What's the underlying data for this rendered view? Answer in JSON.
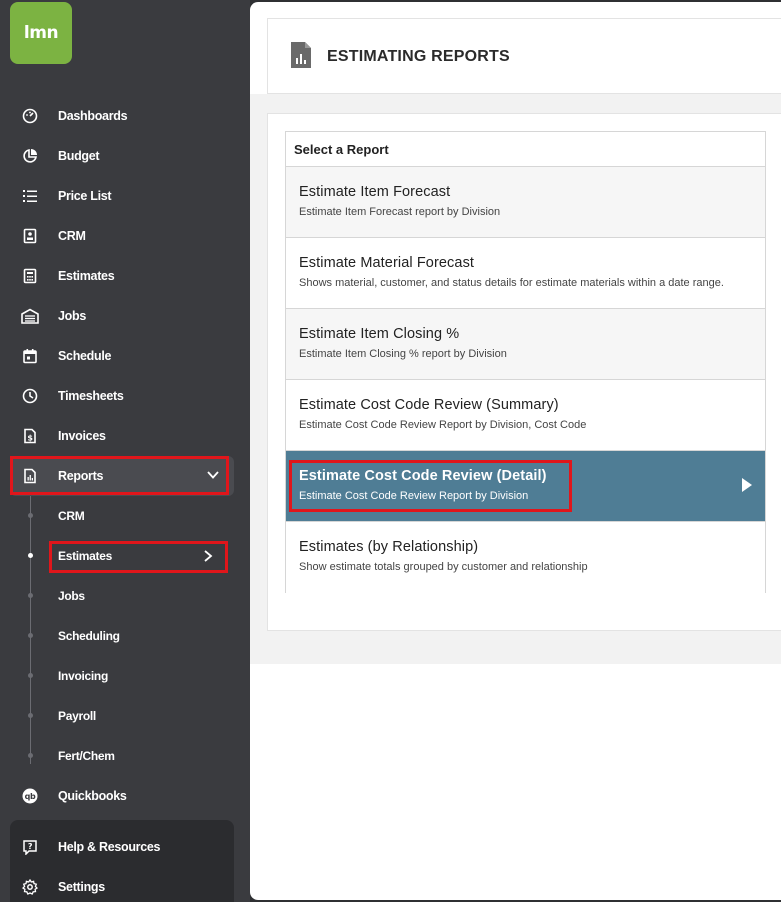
{
  "app": {
    "logo_text": "lmn"
  },
  "sidebar": {
    "items": [
      {
        "label": "Dashboards",
        "icon": "dashboard-gauge-icon"
      },
      {
        "label": "Budget",
        "icon": "pie-chart-icon"
      },
      {
        "label": "Price List",
        "icon": "list-icon"
      },
      {
        "label": "CRM",
        "icon": "contact-card-icon"
      },
      {
        "label": "Estimates",
        "icon": "calculator-icon"
      },
      {
        "label": "Jobs",
        "icon": "garage-icon"
      },
      {
        "label": "Schedule",
        "icon": "calendar-icon"
      },
      {
        "label": "Timesheets",
        "icon": "clock-icon"
      },
      {
        "label": "Invoices",
        "icon": "invoice-dollar-icon"
      },
      {
        "label": "Reports",
        "icon": "report-chart-icon"
      }
    ],
    "reports_submenu": [
      "CRM",
      "Estimates",
      "Jobs",
      "Scheduling",
      "Invoicing",
      "Payroll",
      "Fert/Chem"
    ],
    "quickbooks": {
      "label": "Quickbooks",
      "icon": "quickbooks-icon"
    },
    "help": {
      "label": "Help & Resources",
      "icon": "help-icon"
    },
    "settings": {
      "label": "Settings",
      "icon": "gear-icon"
    }
  },
  "page": {
    "title": "ESTIMATING REPORTS",
    "panel_heading": "Select a Report",
    "reports": [
      {
        "name": "Estimate Item Forecast",
        "description": "Estimate Item Forecast report by Division"
      },
      {
        "name": "Estimate Material Forecast",
        "description": "Shows material, customer, and status details for estimate materials within a date range."
      },
      {
        "name": "Estimate Item Closing %",
        "description": "Estimate Item Closing % report by Division"
      },
      {
        "name": "Estimate Cost Code Review (Summary)",
        "description": "Estimate Cost Code Review Report by Division, Cost Code"
      },
      {
        "name": "Estimate Cost Code Review (Detail)",
        "description": "Estimate Cost Code Review Report by Division"
      },
      {
        "name": "Estimates (by Relationship)",
        "description": "Show estimate totals grouped by customer and relationship"
      }
    ]
  },
  "colors": {
    "sidebar_bg": "#3a3b3f",
    "logo_green": "#7cb342",
    "selected_row": "#4f7d95",
    "highlight_red": "#e0161b"
  }
}
